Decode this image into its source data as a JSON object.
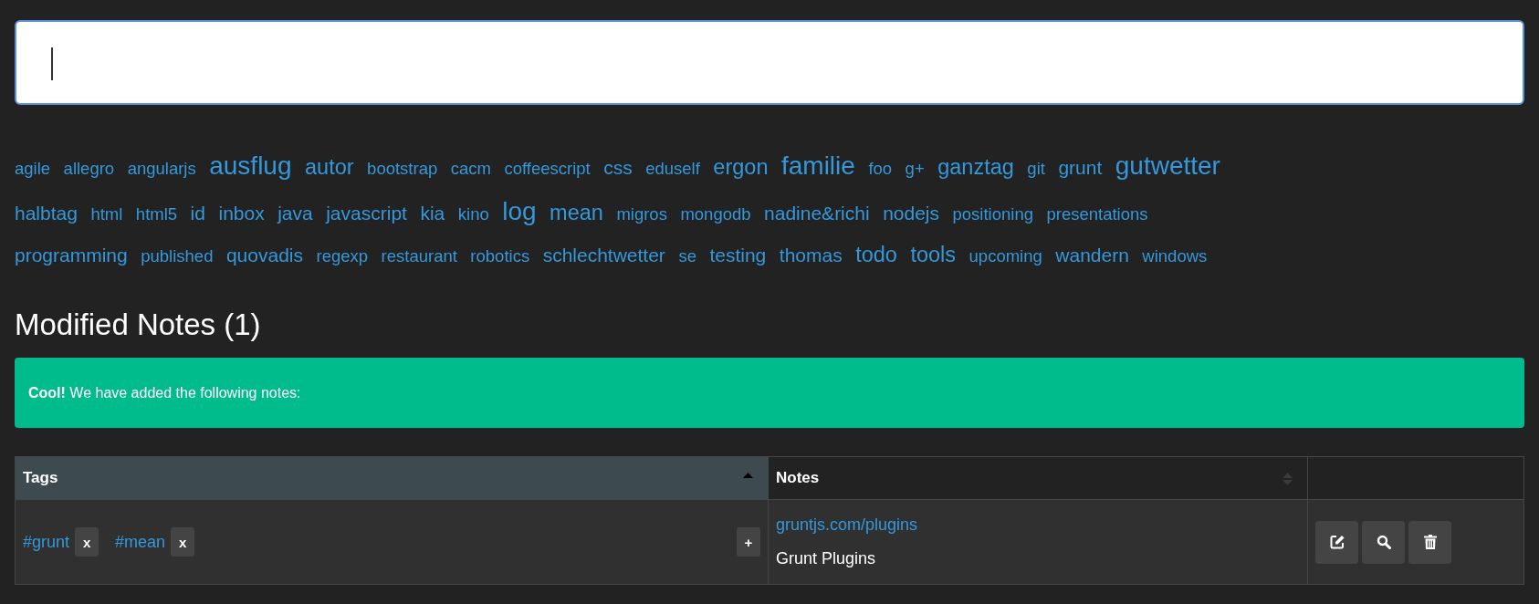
{
  "search": {
    "focused": true
  },
  "tag_cloud": {
    "rows": [
      {
        "tags": [
          {
            "label": "agile",
            "kind": "small"
          },
          {
            "label": "allegro",
            "kind": "small"
          },
          {
            "label": "angularjs",
            "kind": "small"
          },
          {
            "label": "ausflug",
            "kind": "xlarge"
          },
          {
            "label": "autor",
            "kind": "large"
          },
          {
            "label": "bootstrap",
            "kind": "small"
          },
          {
            "label": "cacm",
            "kind": "small"
          },
          {
            "label": "coffeescript",
            "kind": "small"
          },
          {
            "label": "css",
            "kind": "medium"
          },
          {
            "label": "eduself",
            "kind": "small"
          },
          {
            "label": "ergon",
            "kind": "large"
          },
          {
            "label": "familie",
            "kind": "xlarge"
          },
          {
            "label": "foo",
            "kind": "small"
          },
          {
            "label": "g+",
            "kind": "small"
          },
          {
            "label": "ganztag",
            "kind": "large"
          },
          {
            "label": "git",
            "kind": "small"
          },
          {
            "label": "grunt",
            "kind": "medium"
          },
          {
            "label": "gutwetter",
            "kind": "xlarge"
          }
        ]
      },
      {
        "tags": [
          {
            "label": "halbtag",
            "kind": "medium"
          },
          {
            "label": "html",
            "kind": "small"
          },
          {
            "label": "html5",
            "kind": "small"
          },
          {
            "label": "id",
            "kind": "medium"
          },
          {
            "label": "inbox",
            "kind": "medium"
          },
          {
            "label": "java",
            "kind": "medium"
          },
          {
            "label": "javascript",
            "kind": "medium"
          },
          {
            "label": "kia",
            "kind": "medium"
          },
          {
            "label": "kino",
            "kind": "small"
          },
          {
            "label": "log",
            "kind": "xlarge"
          },
          {
            "label": "mean",
            "kind": "large"
          },
          {
            "label": "migros",
            "kind": "small"
          },
          {
            "label": "mongodb",
            "kind": "small"
          },
          {
            "label": "nadine&richi",
            "kind": "medium"
          },
          {
            "label": "nodejs",
            "kind": "medium"
          },
          {
            "label": "positioning",
            "kind": "small"
          },
          {
            "label": "presentations",
            "kind": "small"
          }
        ]
      },
      {
        "tags": [
          {
            "label": "programming",
            "kind": "medium"
          },
          {
            "label": "published",
            "kind": "small"
          },
          {
            "label": "quovadis",
            "kind": "medium"
          },
          {
            "label": "regexp",
            "kind": "small"
          },
          {
            "label": "restaurant",
            "kind": "small"
          },
          {
            "label": "robotics",
            "kind": "small"
          },
          {
            "label": "schlechtwetter",
            "kind": "medium"
          },
          {
            "label": "se",
            "kind": "small"
          },
          {
            "label": "testing",
            "kind": "medium"
          },
          {
            "label": "thomas",
            "kind": "medium"
          },
          {
            "label": "todo",
            "kind": "large"
          },
          {
            "label": "tools",
            "kind": "large"
          },
          {
            "label": "upcoming",
            "kind": "small"
          },
          {
            "label": "wandern",
            "kind": "medium"
          },
          {
            "label": "windows",
            "kind": "small"
          }
        ]
      }
    ]
  },
  "heading": "Modified Notes (1)",
  "alert": {
    "text": "**Cool!** We have added the following notes:"
  },
  "table": {
    "columns": [
      {
        "label": "Tags",
        "sorted": true
      },
      {
        "label": "Notes",
        "sorted": false
      }
    ],
    "rows": [
      {
        "tags": [
          {
            "label": "#grunt",
            "remove": "x"
          },
          {
            "label": "#mean",
            "remove": "x"
          }
        ],
        "add": "+",
        "link": "gruntjs.com/plugins",
        "title": "Grunt Plugins",
        "actions": [
          {
            "kind": "edit"
          },
          {
            "kind": "search"
          },
          {
            "kind": "delete"
          }
        ]
      }
    ]
  }
}
